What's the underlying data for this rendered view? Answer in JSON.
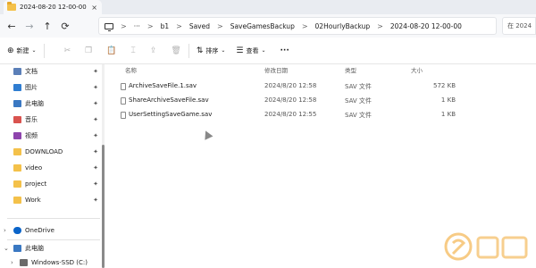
{
  "tab": {
    "title": "2024-08-20 12-00-00",
    "close": "×"
  },
  "nav": {
    "back": "←",
    "forward": "→",
    "up": "↑",
    "refresh": "⟳"
  },
  "breadcrumb": {
    "ellipsis": "···",
    "items": [
      "b1",
      "Saved",
      "SaveGamesBackup",
      "02HourlyBackup",
      "2024-08-20 12-00-00"
    ],
    "separator": ">"
  },
  "search": {
    "placeholder": "在 2024"
  },
  "toolbar": {
    "new_label": "新建",
    "sort_label": "排序",
    "view_label": "查看",
    "more_label": "···"
  },
  "sidebar": {
    "pinned": [
      {
        "label": "文档",
        "icon": "documents-icon",
        "color": "#5b7fb8"
      },
      {
        "label": "图片",
        "icon": "pictures-icon",
        "color": "#2f7dd1"
      },
      {
        "label": "此电脑",
        "icon": "pc-icon",
        "color": "#3a78c2"
      },
      {
        "label": "音乐",
        "icon": "music-icon",
        "color": "#d9534f"
      },
      {
        "label": "视频",
        "icon": "video-icon",
        "color": "#8e44ad"
      },
      {
        "label": "DOWNLOAD",
        "icon": "folder-icon",
        "color": "#f4c14a"
      },
      {
        "label": "video",
        "icon": "folder-icon",
        "color": "#f4c14a"
      },
      {
        "label": "project",
        "icon": "folder-icon",
        "color": "#f4c14a"
      },
      {
        "label": "Work",
        "icon": "folder-icon",
        "color": "#f4c14a"
      }
    ],
    "onedrive": "OneDrive",
    "this_pc": "此电脑",
    "drive": "Windows-SSD (C:)",
    "pin_glyph": "📌"
  },
  "columns": {
    "name": "名称",
    "modified": "修改日期",
    "type": "类型",
    "size": "大小"
  },
  "files": [
    {
      "name": "ArchiveSaveFile.1.sav",
      "modified": "2024/8/20 12:58",
      "type": "SAV 文件",
      "size": "572 KB"
    },
    {
      "name": "ShareArchiveSaveFile.sav",
      "modified": "2024/8/20 12:58",
      "type": "SAV 文件",
      "size": "1 KB"
    },
    {
      "name": "UserSettingSaveGame.sav",
      "modified": "2024/8/20 12:55",
      "type": "SAV 文件",
      "size": "1 KB"
    }
  ],
  "colors": {
    "accent": "#0067c0",
    "folder": "#f4c14a",
    "watermark": "#f0a020"
  }
}
